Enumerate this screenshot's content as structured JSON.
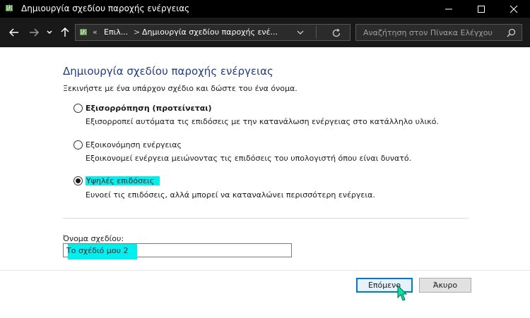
{
  "window": {
    "title": "Δημιουργία σχεδίου παροχής ενέργειας",
    "controls": [
      "minimize",
      "maximize",
      "close"
    ]
  },
  "address_bar": {
    "overflow": "«",
    "crumbs": [
      "Επιλ...",
      "Δημιουργία σχεδίου παροχής ενέ..."
    ],
    "separator": ">"
  },
  "search": {
    "placeholder": "Αναζήτηση στον Πίνακα Ελέγχου"
  },
  "content": {
    "heading": "Δημιουργία σχεδίου παροχής ενέργειας",
    "intro": "Ξεκινήστε με ένα υπάρχον σχέδιο και δώστε του ένα όνομα.",
    "plans": [
      {
        "label": "Εξισορρόπηση (προτείνεται)",
        "description": "Εξισορροπεί αυτόματα τις επιδόσεις με την κατανάλωση ενέργειας στο κατάλληλο υλικό.",
        "selected": false
      },
      {
        "label": "Εξοικονόμηση ενέργειας",
        "description": "Εξοικονομεί ενέργεια μειώνοντας τις επιδόσεις του υπολογιστή όπου είναι δυνατό.",
        "selected": false
      },
      {
        "label": "Υψηλές επιδόσεις",
        "description": "Ευνοεί τις επιδόσεις, αλλά μπορεί να καταναλώνει περισσότερη ενέργεια.",
        "selected": true
      }
    ],
    "plan_name_label": "Όνομα σχεδίου:",
    "plan_name_value": "Το σχέδιό μου 2"
  },
  "buttons": {
    "next": "Επόμενο",
    "cancel": "Άκυρο"
  },
  "colors": {
    "heading": "#1e3b93",
    "highlight": "#00f0f0",
    "titlebar": "#000000",
    "navbar": "#191919",
    "cursor": "#00e5a0"
  }
}
